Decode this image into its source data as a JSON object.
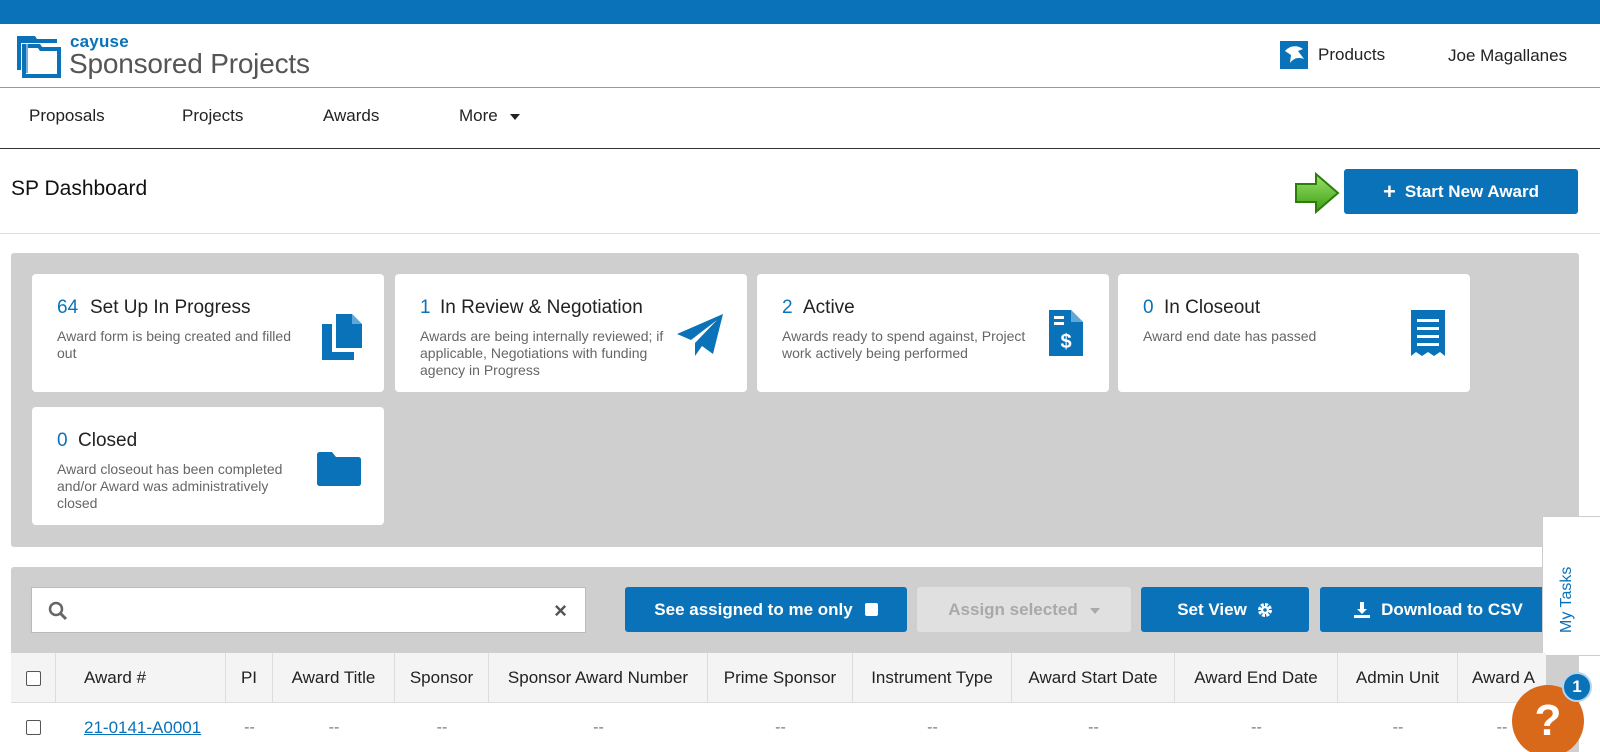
{
  "app": {
    "brand_small": "cayuse",
    "brand_big": "Sponsored Projects",
    "products_label": "Products",
    "user_name": "Joe Magallanes"
  },
  "nav": {
    "items": [
      {
        "label": "Proposals"
      },
      {
        "label": "Projects"
      },
      {
        "label": "Awards"
      },
      {
        "label": "More"
      }
    ]
  },
  "page": {
    "title": "SP Dashboard",
    "start_button_label": "Start New Award"
  },
  "stats": [
    {
      "count": "64",
      "title": "Set Up In Progress",
      "description": "Award form is being created and filled out",
      "icon": "copy-documents-icon"
    },
    {
      "count": "1",
      "title": "In Review & Negotiation",
      "description": "Awards are being internally reviewed; if applicable, Negotiations with funding agency in Progress",
      "icon": "paper-plane-icon"
    },
    {
      "count": "2",
      "title": "Active",
      "description": "Awards ready to spend against, Project work actively being performed",
      "icon": "dollar-document-icon"
    },
    {
      "count": "0",
      "title": "In Closeout",
      "description": "Award end date has passed",
      "icon": "receipt-icon"
    },
    {
      "count": "0",
      "title": "Closed",
      "description": "Award closeout has been completed and/or Award was administratively closed",
      "icon": "folder-icon"
    }
  ],
  "toolbar": {
    "search_value": "",
    "assigned_label": "See assigned to me only",
    "assign_selected_label": "Assign selected",
    "set_view_label": "Set View",
    "download_label": "Download to CSV"
  },
  "tasks_tab": {
    "label": "My Tasks"
  },
  "table": {
    "columns": [
      "Award #",
      "PI",
      "Award Title",
      "Sponsor",
      "Sponsor Award Number",
      "Prime Sponsor",
      "Instrument Type",
      "Award Start Date",
      "Award End Date",
      "Admin Unit",
      "Award A"
    ],
    "rows": [
      {
        "award_number": "21-0141-A0001",
        "pi": "--",
        "award_title": "--",
        "sponsor": "--",
        "sponsor_award_number": "--",
        "prime_sponsor": "--",
        "instrument_type": "--",
        "start_date": "--",
        "end_date": "--",
        "admin_unit": "--",
        "award_a": "--"
      }
    ]
  },
  "help": {
    "symbol": "?",
    "badge_count": "1"
  },
  "colors": {
    "brand": "#0a72b8",
    "panel_gray": "#cfcfcf",
    "help_orange": "#d9691a",
    "arrow_green": "#4caf1c"
  }
}
